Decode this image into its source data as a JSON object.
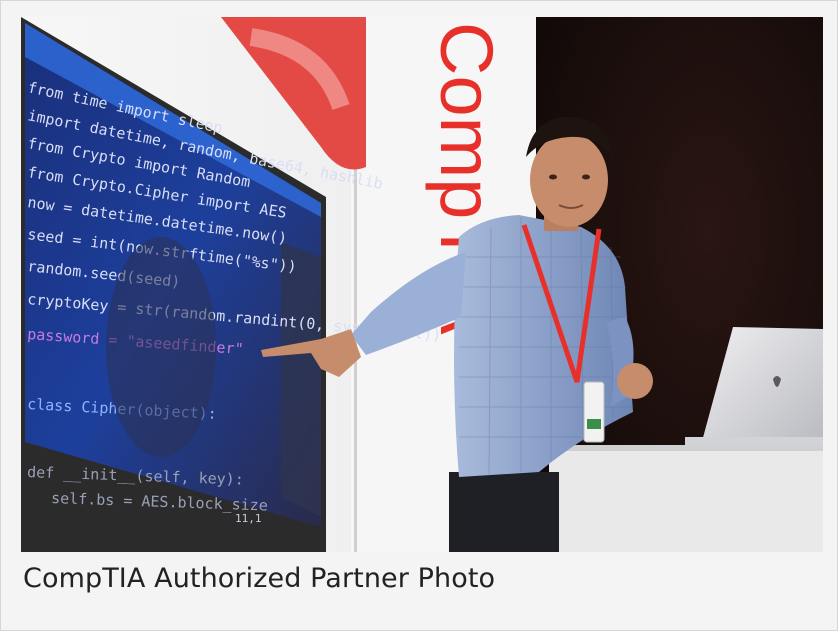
{
  "caption": "CompTIA Authorized Partner Photo",
  "photo": {
    "wall_brand_text": "CompTIA",
    "code_lines": [
      "from time import sleep",
      "import datetime, random, base64, hashlib",
      "from Crypto import Random",
      "from Crypto.Cipher import AES",
      "now = datetime.datetime.now()",
      "seed = int(now.strftime(\"%s\"))",
      "random.seed(seed)",
      "cryptoKey = str(random.randint(0, sys.maxint))",
      "password = \"aseedfinder\"",
      "class Cipher(object):",
      "  def __init__(self, key):",
      "    self.bs = AES.block_size"
    ],
    "status_text": "11,1",
    "colors": {
      "brand_red": "#e8302b",
      "screen_blue": "#1d3f9c",
      "shirt_blue": "#8aa3cc"
    }
  }
}
